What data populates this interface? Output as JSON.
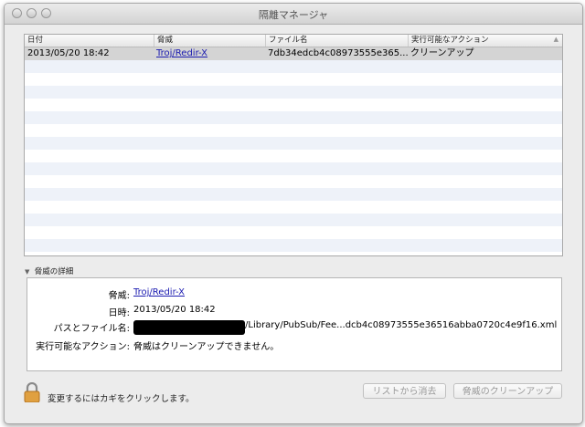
{
  "window": {
    "title": "隔離マネージャ"
  },
  "table": {
    "columns": [
      "日付",
      "脅威",
      "ファイル名",
      "実行可能なアクション"
    ],
    "rows": [
      {
        "date": "2013/05/20 18:42",
        "threat": "Troj/Redir-X",
        "file": "7db34edcb4c08973555e365...",
        "action": "クリーンアップ"
      }
    ]
  },
  "details": {
    "section_label": "脅威の詳細",
    "threat_label": "脅威:",
    "threat_value": "Troj/Redir-X",
    "datetime_label": "日時:",
    "datetime_value": "2013/05/20 18:42",
    "path_label": "パスとファイル名:",
    "path_value": "/Library/PubSub/Fee...dcb4c08973555e36516abba0720c4e9f16.xml",
    "action_label": "実行可能なアクション:",
    "action_value": "脅威はクリーンアップできません。"
  },
  "footer": {
    "lock_text": "変更するにはカギをクリックします。",
    "remove_button": "リストから消去",
    "cleanup_button": "脅威のクリーンアップ"
  }
}
